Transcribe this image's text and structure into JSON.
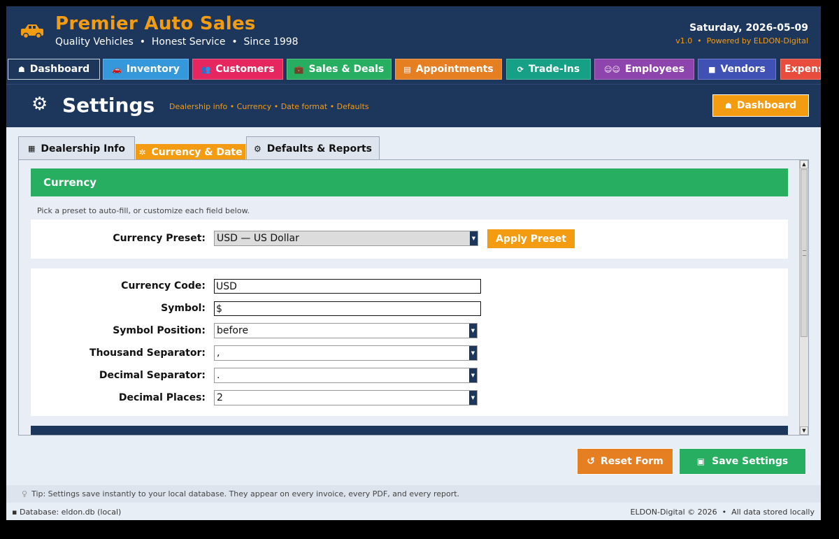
{
  "header": {
    "brand": "Premier Auto Sales",
    "tagline": "Quality Vehicles  •  Honest Service  •  Since 1998",
    "date": "Saturday, 2026-05-09",
    "version": "v1.0  •  Powered by ELDON-Digital",
    "logo_icon": "car-icon"
  },
  "nav": [
    {
      "label": "Dashboard",
      "icon": "home-icon",
      "color": "#1d365c"
    },
    {
      "label": "Inventory",
      "icon": "car-icon",
      "color": "#3498db"
    },
    {
      "label": "Customers",
      "icon": "users-icon",
      "color": "#e6275f"
    },
    {
      "label": "Sales & Deals",
      "icon": "briefcase-icon",
      "color": "#27ae60"
    },
    {
      "label": "Appointments",
      "icon": "calendar-icon",
      "color": "#e67e22"
    },
    {
      "label": "Trade-Ins",
      "icon": "refresh-icon",
      "color": "#16a085"
    },
    {
      "label": "Employees",
      "icon": "people-icon",
      "color": "#8e44ad"
    },
    {
      "label": "Vendors",
      "icon": "box-icon",
      "color": "#3f51b5"
    },
    {
      "label": "Expens",
      "icon": "",
      "color": "#e74c3c"
    }
  ],
  "titlebar": {
    "title": "Settings",
    "subtitle": "Dealership info • Currency • Date format • Defaults",
    "dashboard_button": "Dashboard"
  },
  "tabs": [
    {
      "label": "Dealership Info",
      "icon": "building-icon"
    },
    {
      "label": "Currency & Date",
      "icon": "gear-icon",
      "active": true
    },
    {
      "label": "Defaults & Reports",
      "icon": "gear-icon"
    }
  ],
  "currency": {
    "section_title": "Currency",
    "hint": "Pick a preset to auto-fill, or customize each field below.",
    "preset_label": "Currency Preset:",
    "preset_value": "USD — US Dollar",
    "apply_button": "Apply Preset",
    "fields": {
      "code_label": "Currency Code:",
      "code_value": "USD",
      "symbol_label": "Symbol:",
      "symbol_value": "$",
      "position_label": "Symbol Position:",
      "position_value": "before",
      "thousand_label": "Thousand Separator:",
      "thousand_value": ",",
      "decimal_label": "Decimal Separator:",
      "decimal_value": ".",
      "places_label": "Decimal Places:",
      "places_value": "2"
    }
  },
  "actions": {
    "reset": "Reset Form",
    "save": "Save Settings"
  },
  "footer": {
    "tip": "Tip: Settings save instantly to your local database. They appear on every invoice, every PDF, and every report.",
    "database": "Database: eldon.db (local)",
    "copyright": "ELDON-Digital © 2026  •  All data stored locally"
  }
}
